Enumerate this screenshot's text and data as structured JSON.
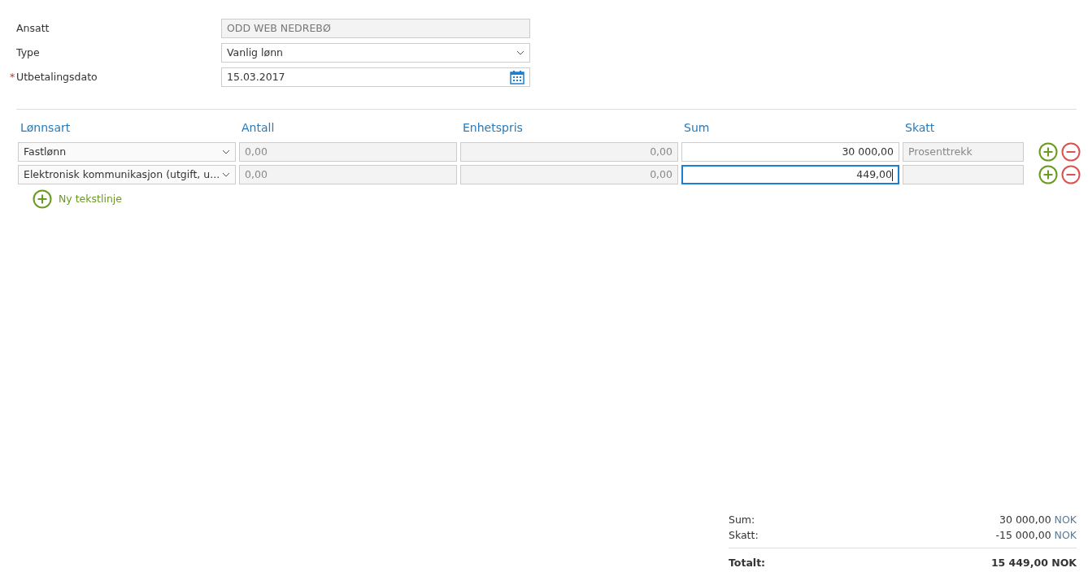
{
  "form": [
    {
      "label": "Ansatt",
      "kind": "text",
      "value": "ODD WEB NEDREBØ",
      "disabled": true
    },
    {
      "label": "Type",
      "kind": "select",
      "value": "Vanlig lønn",
      "disabled": false
    },
    {
      "label": "Utbetalingsdato",
      "required_mark": "*",
      "kind": "date",
      "value": "15.03.2017",
      "disabled": false
    }
  ],
  "table": {
    "columns": [
      "Lønnsart",
      "Antall",
      "Enhetspris",
      "Sum",
      "Skatt"
    ],
    "rows": [
      {
        "cells": [
          {
            "kind": "select",
            "value": "Fastlønn",
            "disabled": false,
            "focused": false
          },
          {
            "kind": "text",
            "value": "0,00",
            "disabled": true,
            "focused": false
          },
          {
            "kind": "number",
            "value": "0,00",
            "disabled": true,
            "focused": false
          },
          {
            "kind": "number",
            "value": "30 000,00",
            "disabled": false,
            "focused": false
          },
          {
            "kind": "text",
            "value": "Prosenttrekk",
            "disabled": true,
            "focused": false
          }
        ]
      },
      {
        "cells": [
          {
            "kind": "select",
            "value": "Elektronisk kommunikasjon (utgift, u...",
            "disabled": false,
            "focused": false
          },
          {
            "kind": "text",
            "value": "0,00",
            "disabled": true,
            "focused": false
          },
          {
            "kind": "number",
            "value": "0,00",
            "disabled": true,
            "focused": false
          },
          {
            "kind": "number",
            "value": "449,00",
            "disabled": false,
            "focused": true
          },
          {
            "kind": "text",
            "disabled": true,
            "focused": false
          }
        ]
      }
    ]
  },
  "add_line": "Ny tekstlinje",
  "totals": [
    {
      "label": "Sum:",
      "value": "30 000,00",
      "currency": "NOK",
      "total": false
    },
    {
      "label": "Skatt:",
      "value": "-15 000,00",
      "currency": "NOK",
      "total": false
    },
    {
      "label": "Totalt:",
      "value": "15 449,00",
      "currency": "NOK",
      "total": true
    }
  ]
}
